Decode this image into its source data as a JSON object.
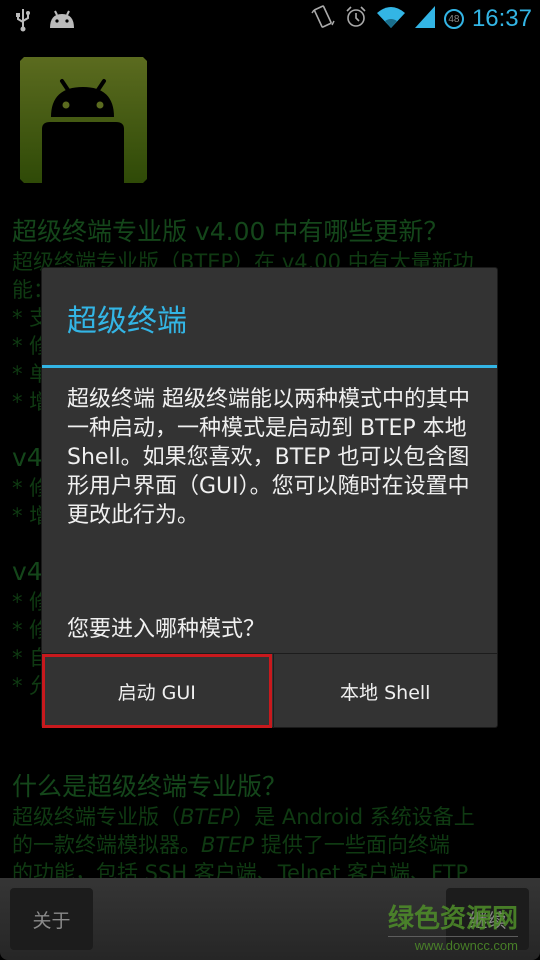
{
  "status_bar": {
    "left_icons": [
      "usb-icon",
      "android-notification-icon"
    ],
    "right_icons": [
      "vibrate-icon",
      "alarm-icon",
      "wifi-icon",
      "signal-icon"
    ],
    "battery_level": "48",
    "time": "16:37",
    "accent_color": "#33b5e5"
  },
  "background_page": {
    "whats_new_heading": "超级终端专业版 v4.00 中有哪些更新？",
    "whats_new_intro": "超级终端专业版（BTEP）在 v4.00 中有大量新功",
    "whats_new_line2": "能：",
    "v400_items": [
      "* 支",
      "* 修",
      "* 单",
      "* 增"
    ],
    "v4_a_heading": "v4",
    "v4_a_items": [
      "* 修",
      "* 增"
    ],
    "v4_b_heading": "v4",
    "v4_b_items": [
      "* 修",
      "* 修",
      "* 自",
      "* 允"
    ],
    "about_heading": "什么是超级终端专业版？",
    "about_line1_a": "超级终端专业版（",
    "about_line1_b": "BTEP",
    "about_line1_c": "）是 Android 系统设备上",
    "about_line2_a": "的一款终端模拟器。",
    "about_line2_b": "BTEP",
    "about_line2_c": " 提供了一些面向终端",
    "about_line3": "的功能，包括 SSH 客户端、Telnet 客户端、FTP"
  },
  "dialog": {
    "title": "超级终端",
    "message": "超级终端 超级终端能以两种模式中的其中一种启动，一种模式是启动到 BTEP 本地 Shell。如果您喜欢，BTEP 也可以包含图形用户界面（GUI）。您可以随时在设置中更改此行为。",
    "question": "您要进入哪种模式？",
    "buttons": {
      "launch_gui": "启动 GUI",
      "local_shell": "本地 Shell"
    },
    "highlight_color": "#c8191d"
  },
  "bottom_bar": {
    "about_label": "关于",
    "continue_label": "继续"
  },
  "watermark": {
    "name": "绿色资源网",
    "url": "www.downcc.com"
  }
}
